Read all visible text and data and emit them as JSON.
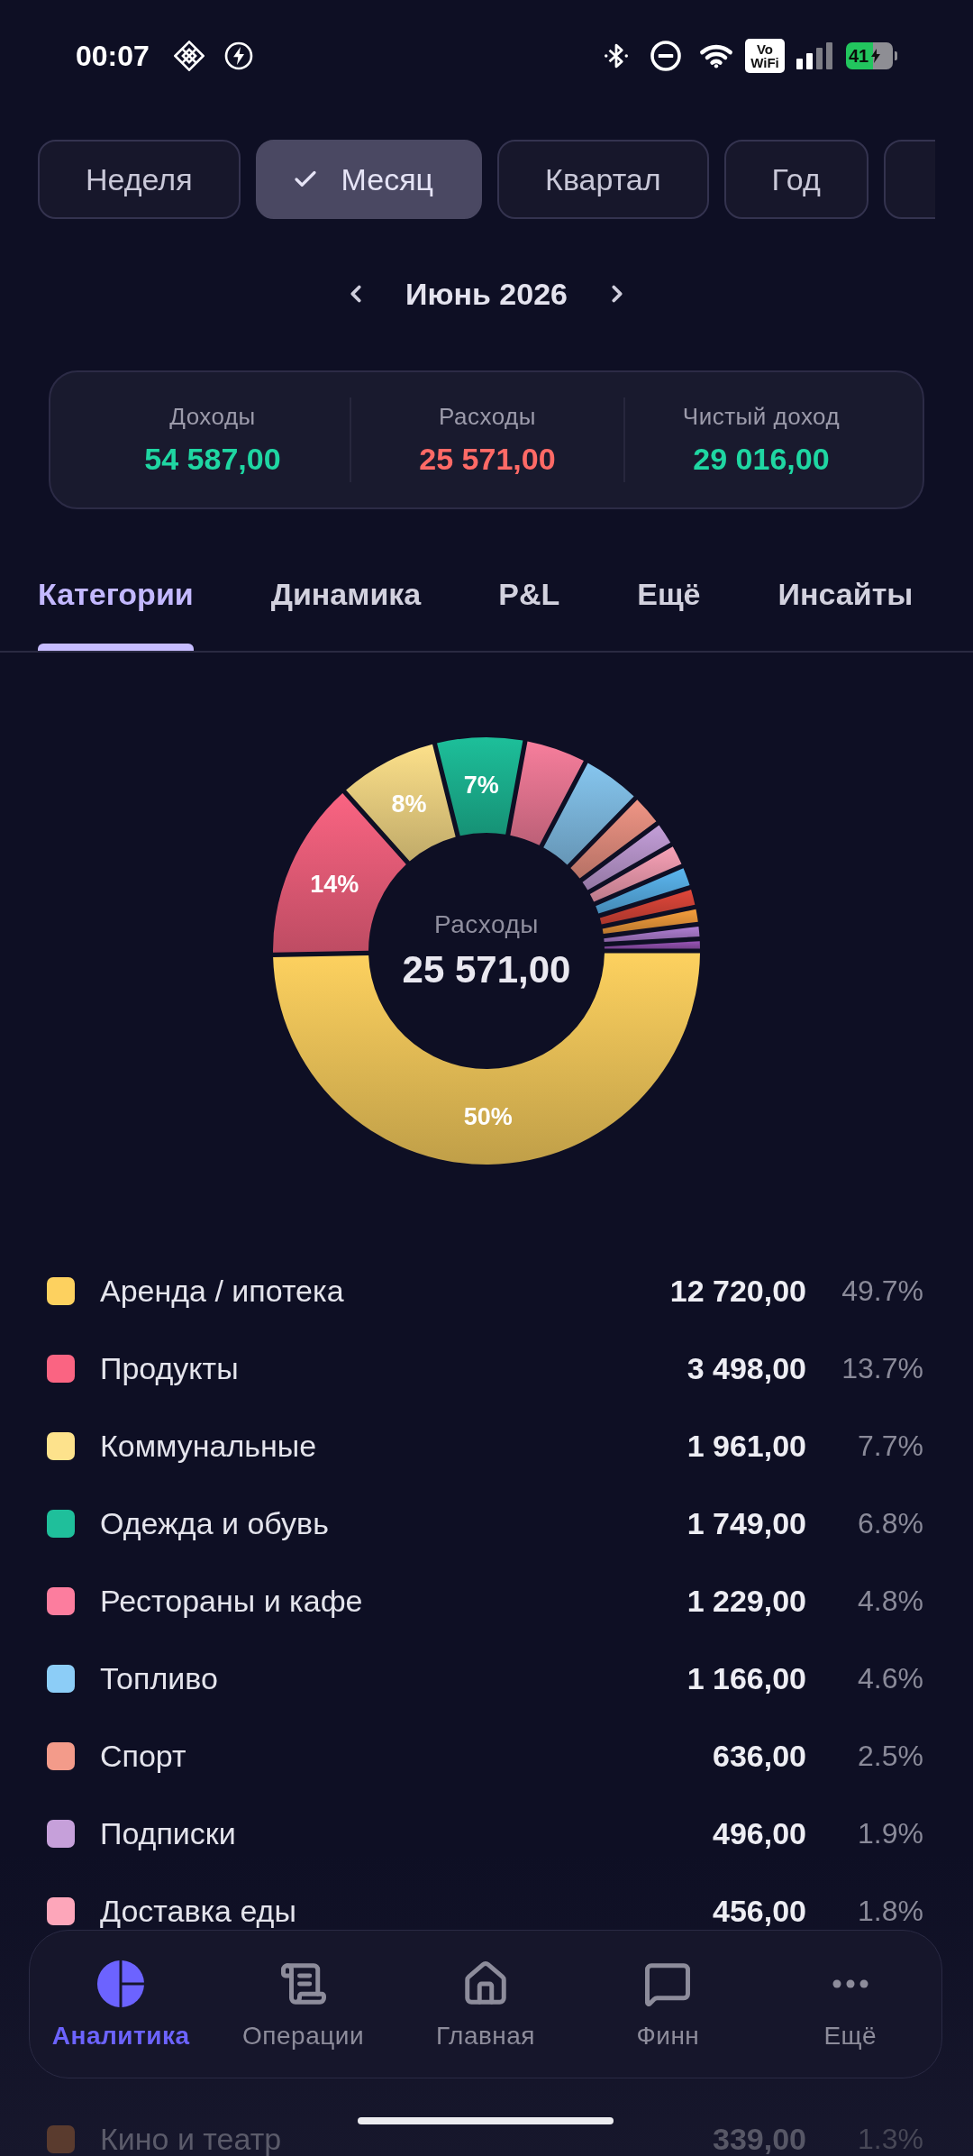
{
  "status_bar": {
    "time": "00:07",
    "vowifi": "Vo WiFi",
    "battery": "41"
  },
  "periods": [
    {
      "label": "Неделя",
      "selected": false
    },
    {
      "label": "Месяц",
      "selected": true
    },
    {
      "label": "Квартал",
      "selected": false
    },
    {
      "label": "Год",
      "selected": false
    },
    {
      "selected": false
    }
  ],
  "period_nav": {
    "label": "Июнь 2026"
  },
  "summary": [
    {
      "label": "Доходы",
      "value": "54 587,00",
      "kind": "positive"
    },
    {
      "label": "Расходы",
      "value": "25 571,00",
      "kind": "negative"
    },
    {
      "label": "Чистый доход",
      "value": "29 016,00",
      "kind": "positive"
    }
  ],
  "tabs": [
    {
      "label": "Категории",
      "selected": true
    },
    {
      "label": "Динамика",
      "selected": false
    },
    {
      "label": "P&L",
      "selected": false
    },
    {
      "label": "Ещё",
      "selected": false
    },
    {
      "label": "Инсайты",
      "selected": false
    }
  ],
  "donut": {
    "center_label": "Расходы",
    "center_value": "25 571,00",
    "chart_data": {
      "type": "donut",
      "values": [
        49.7,
        13.7,
        7.7,
        6.8,
        4.8,
        4.6,
        2.5,
        1.9,
        1.8,
        1.7,
        1.5,
        1.3,
        1.1,
        0.9
      ],
      "colors": [
        "#fdd15f",
        "#fa6482",
        "#fce08a",
        "#1dbf9a",
        "#f77e9c",
        "#86c6ef",
        "#ef9585",
        "#c39ed8",
        "#f7a1b6",
        "#5bb6ef",
        "#e0473a",
        "#f59e3c",
        "#b07fd4",
        "#9a55b8"
      ],
      "value_labels": [
        "50%",
        "14%",
        "8%",
        "7%",
        null,
        null,
        null,
        null,
        null,
        null,
        null,
        null,
        null,
        null
      ]
    }
  },
  "categories": [
    {
      "name": "Аренда / ипотека",
      "amount": "12 720,00",
      "share": "49.7%",
      "color": "#fdd15f",
      "faded": false
    },
    {
      "name": "Продукты",
      "amount": "3 498,00",
      "share": "13.7%",
      "color": "#fa6482",
      "faded": false
    },
    {
      "name": "Коммунальные",
      "amount": "1 961,00",
      "share": "7.7%",
      "color": "#fde28c",
      "faded": false
    },
    {
      "name": "Одежда и обувь",
      "amount": "1 749,00",
      "share": "6.8%",
      "color": "#1fbf9b",
      "faded": false
    },
    {
      "name": "Рестораны и кафе",
      "amount": "1 229,00",
      "share": "4.8%",
      "color": "#fc7d9e",
      "faded": false
    },
    {
      "name": "Топливо",
      "amount": "1 166,00",
      "share": "4.6%",
      "color": "#8ccdf7",
      "faded": false
    },
    {
      "name": "Спорт",
      "amount": "636,00",
      "share": "2.5%",
      "color": "#f39b8a",
      "faded": false
    },
    {
      "name": "Подписки",
      "amount": "496,00",
      "share": "1.9%",
      "color": "#c6a0da",
      "faded": false
    },
    {
      "name": "Доставка еды",
      "amount": "456,00",
      "share": "1.8%",
      "color": "#fda6ba",
      "faded": false
    },
    {
      "name": "Кино и театр",
      "amount": "339,00",
      "share": "1.3%",
      "color": "#5a3b2e",
      "faded": true
    }
  ],
  "bottom_nav": [
    {
      "label": "Аналитика",
      "selected": true
    },
    {
      "label": "Операции",
      "selected": false
    },
    {
      "label": "Главная",
      "selected": false
    },
    {
      "label": "Финн",
      "selected": false
    },
    {
      "label": "Ещё",
      "selected": false
    }
  ]
}
